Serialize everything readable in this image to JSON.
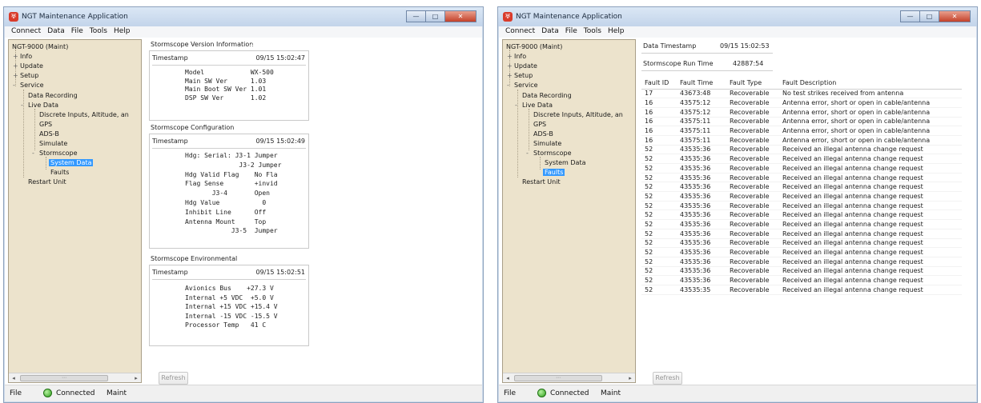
{
  "app": {
    "title": "NGT Maintenance Application",
    "icon": "app-logo-icon"
  },
  "caption": {
    "minimize": "—",
    "maximize": "□",
    "close": "✕"
  },
  "menu": [
    "Connect",
    "Data",
    "File",
    "Tools",
    "Help"
  ],
  "tree": {
    "root": "NGT-9000 (Maint)",
    "info": "Info",
    "update": "Update",
    "setup": "Setup",
    "service": "Service",
    "data_recording": "Data Recording",
    "live_data": "Live Data",
    "discrete_inputs": "Discrete Inputs, Altitude, an",
    "gps": "GPS",
    "adsb": "ADS-B",
    "simulate": "Simulate",
    "stormscope": "Stormscope",
    "system_data": "System Data",
    "faults": "Faults",
    "restart_unit": "Restart Unit",
    "scroll_thumb": "⋯"
  },
  "status": {
    "file": "File",
    "connection": "Connected",
    "mode": "Maint"
  },
  "refresh_label": "Refresh",
  "win1": {
    "version": {
      "title": "Stormscope Version Information",
      "timestamp_label": "Timestamp",
      "timestamp": "09/15 15:02:47",
      "rows": [
        "Model            WX-500",
        "Main SW Ver      1.03",
        "Main Boot SW Ver 1.01",
        "DSP SW Ver       1.02"
      ]
    },
    "config": {
      "title": "Stormscope Configuration",
      "timestamp_label": "Timestamp",
      "timestamp": "09/15 15:02:49",
      "rows": [
        "Hdg: Serial: J3-1 Jumper",
        "              J3-2 Jumper",
        "Hdg Valid Flag    No Fla",
        "Flag Sense        +invid",
        "       J3-4       Open",
        "Hdg Value           0",
        "Inhibit Line      Off",
        "Antenna Mount     Top",
        "            J3-5  Jumper"
      ]
    },
    "env": {
      "title": "Stormscope Environmental",
      "timestamp_label": "Timestamp",
      "timestamp": "09/15 15:02:51",
      "rows": [
        "Avionics Bus    +27.3 V",
        "Internal +5 VDC  +5.0 V",
        "Internal +15 VDC +15.4 V",
        "Internal -15 VDC -15.5 V",
        "Processor Temp   41 C"
      ]
    }
  },
  "win2": {
    "data_timestamp_label": "Data Timestamp",
    "data_timestamp": "09/15 15:02:53",
    "run_time_label": "Stormscope Run Time",
    "run_time": "42887:54",
    "columns": [
      "Fault ID",
      "Fault Time",
      "Fault Type",
      "Fault Description"
    ],
    "rows": [
      [
        "17",
        "43673:48",
        "Recoverable",
        "No test strikes received from antenna"
      ],
      [
        "16",
        "43575:12",
        "Recoverable",
        "Antenna error, short or open in cable/antenna"
      ],
      [
        "16",
        "43575:12",
        "Recoverable",
        "Antenna error, short or open in cable/antenna"
      ],
      [
        "16",
        "43575:11",
        "Recoverable",
        "Antenna error, short or open in cable/antenna"
      ],
      [
        "16",
        "43575:11",
        "Recoverable",
        "Antenna error, short or open in cable/antenna"
      ],
      [
        "16",
        "43575:11",
        "Recoverable",
        "Antenna error, short or open in cable/antenna"
      ],
      [
        "52",
        "43535:36",
        "Recoverable",
        "Received an illegal antenna change request"
      ],
      [
        "52",
        "43535:36",
        "Recoverable",
        "Received an illegal antenna change request"
      ],
      [
        "52",
        "43535:36",
        "Recoverable",
        "Received an illegal antenna change request"
      ],
      [
        "52",
        "43535:36",
        "Recoverable",
        "Received an illegal antenna change request"
      ],
      [
        "52",
        "43535:36",
        "Recoverable",
        "Received an illegal antenna change request"
      ],
      [
        "52",
        "43535:36",
        "Recoverable",
        "Received an illegal antenna change request"
      ],
      [
        "52",
        "43535:36",
        "Recoverable",
        "Received an illegal antenna change request"
      ],
      [
        "52",
        "43535:36",
        "Recoverable",
        "Received an illegal antenna change request"
      ],
      [
        "52",
        "43535:36",
        "Recoverable",
        "Received an illegal antenna change request"
      ],
      [
        "52",
        "43535:36",
        "Recoverable",
        "Received an illegal antenna change request"
      ],
      [
        "52",
        "43535:36",
        "Recoverable",
        "Received an illegal antenna change request"
      ],
      [
        "52",
        "43535:36",
        "Recoverable",
        "Received an illegal antenna change request"
      ],
      [
        "52",
        "43535:36",
        "Recoverable",
        "Received an illegal antenna change request"
      ],
      [
        "52",
        "43535:36",
        "Recoverable",
        "Received an illegal antenna change request"
      ],
      [
        "52",
        "43535:36",
        "Recoverable",
        "Received an illegal antenna change request"
      ],
      [
        "52",
        "43535:35",
        "Recoverable",
        "Received an illegal antenna change request"
      ]
    ]
  }
}
